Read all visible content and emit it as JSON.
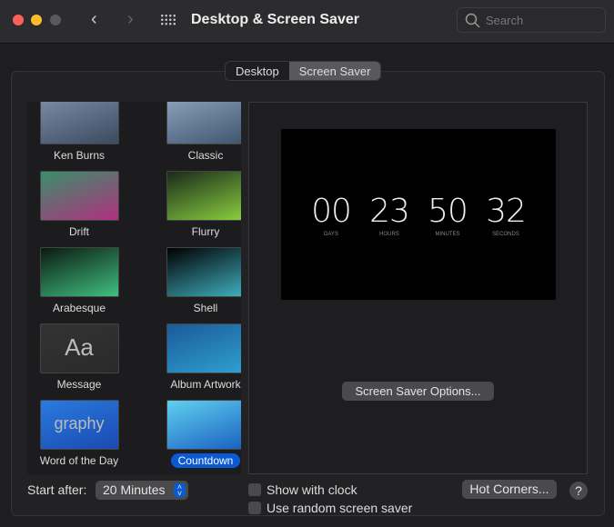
{
  "window": {
    "title": "Desktop & Screen Saver",
    "search_placeholder": "Search"
  },
  "tabs": [
    {
      "label": "Desktop",
      "selected": false
    },
    {
      "label": "Screen Saver",
      "selected": true
    }
  ],
  "savers": [
    {
      "label": "Ken Burns",
      "colors": [
        "#7e8ea6",
        "#3c4a60"
      ]
    },
    {
      "label": "Classic",
      "colors": [
        "#8fa3bd",
        "#3e5570"
      ]
    },
    {
      "label": "Drift",
      "colors": [
        "#3a8f6a",
        "#b03080"
      ]
    },
    {
      "label": "Flurry",
      "colors": [
        "#1a2a1a",
        "#8ad040"
      ]
    },
    {
      "label": "Arabesque",
      "colors": [
        "#0a1a10",
        "#40c080"
      ]
    },
    {
      "label": "Shell",
      "colors": [
        "#000",
        "#40b0c0"
      ]
    },
    {
      "label": "Message",
      "colors": [
        "#333",
        "#2a2a2a"
      ],
      "text": "Aa"
    },
    {
      "label": "Album Artwork",
      "colors": [
        "#1a5a9a",
        "#2fa0d0"
      ]
    },
    {
      "label": "Word of the Day",
      "colors": [
        "#2a7ae0",
        "#1a4ab0"
      ],
      "text": "graphy"
    },
    {
      "label": "Countdown",
      "colors": [
        "#60d0f0",
        "#1a60c0"
      ],
      "selected": true
    }
  ],
  "countdown": [
    {
      "value": "00",
      "unit": "DAYS"
    },
    {
      "value": "23",
      "unit": "HOURS"
    },
    {
      "value": "50",
      "unit": "MINUTES"
    },
    {
      "value": "32",
      "unit": "SECONDS"
    }
  ],
  "options_button": "Screen Saver Options...",
  "start_after": {
    "label": "Start after:",
    "value": "20 Minutes"
  },
  "show_with_clock": {
    "label": "Show with clock",
    "checked": false
  },
  "random_saver": {
    "label": "Use random screen saver",
    "checked": false
  },
  "hot_corners": "Hot Corners...",
  "help": "?"
}
